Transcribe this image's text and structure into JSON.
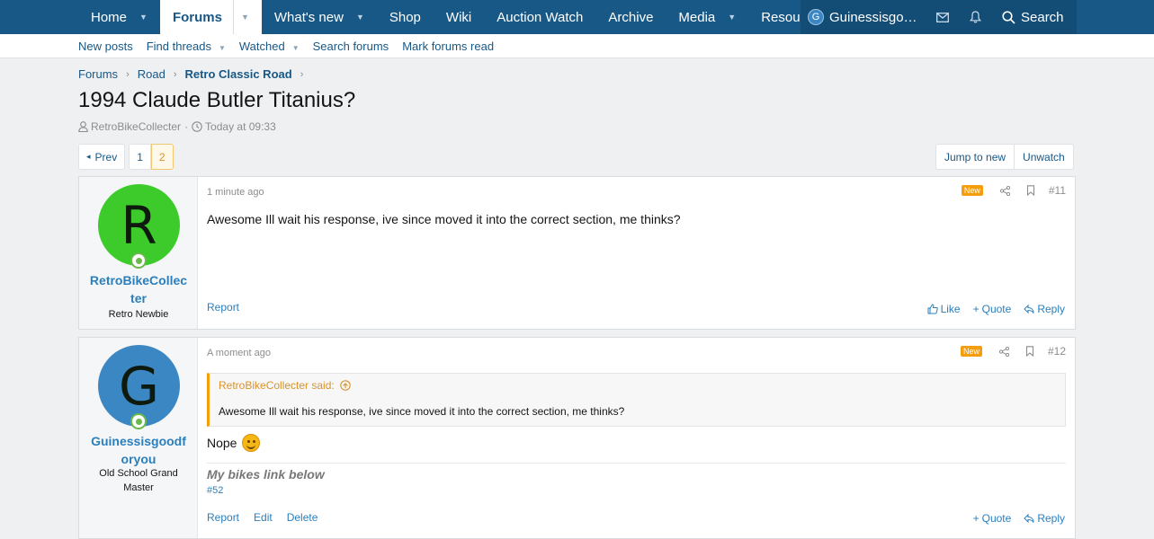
{
  "nav": {
    "tabs": [
      "Home",
      "Forums",
      "What's new",
      "Shop",
      "Wiki",
      "Auction Watch",
      "Archive",
      "Media",
      "Resources"
    ],
    "user": "Guinessisgo…",
    "user_initial": "G",
    "search": "Search"
  },
  "subnav": [
    "New posts",
    "Find threads",
    "Watched",
    "Search forums",
    "Mark forums read"
  ],
  "breadcrumb": [
    "Forums",
    "Road",
    "Retro Classic Road"
  ],
  "thread": {
    "title": "1994 Claude Butler Titanius?",
    "author": "RetroBikeCollecter",
    "time": "Today at 09:33"
  },
  "pager": {
    "prev": "Prev",
    "pages": [
      "1",
      "2"
    ],
    "current": "2"
  },
  "top_actions": {
    "jump": "Jump to new",
    "unwatch": "Unwatch"
  },
  "colors": {
    "nav": "#185886",
    "accent": "#f49d0d",
    "link": "#2a7fbc",
    "avatar_r": "#3ccb2a",
    "avatar_g": "#3b87c4"
  },
  "posts": [
    {
      "initial": "R",
      "username_1": "RetroBikeCollec",
      "username_2": "ter",
      "user_title": "Retro Newbie",
      "time": "1 minute ago",
      "badge": "New",
      "number": "#11",
      "message": "Awesome Ill wait his response, ive since moved it into the correct section, me thinks?",
      "report": "Report",
      "like": "Like",
      "quote": "Quote",
      "reply": "Reply"
    },
    {
      "initial": "G",
      "username_1": "Guinessisgoodf",
      "username_2": "oryou",
      "user_title_1": "Old School Grand",
      "user_title_2": "Master",
      "time": "A moment ago",
      "badge": "New",
      "number": "#12",
      "quote_author": "RetroBikeCollecter said:",
      "quote_text": "Awesome Ill wait his response, ive since moved it into the correct section, me thinks?",
      "message": "Nope",
      "signature": "My bikes link below",
      "signature_link": "#52",
      "report": "Report",
      "edit": "Edit",
      "delete": "Delete",
      "quote": "Quote",
      "reply": "Reply"
    }
  ]
}
